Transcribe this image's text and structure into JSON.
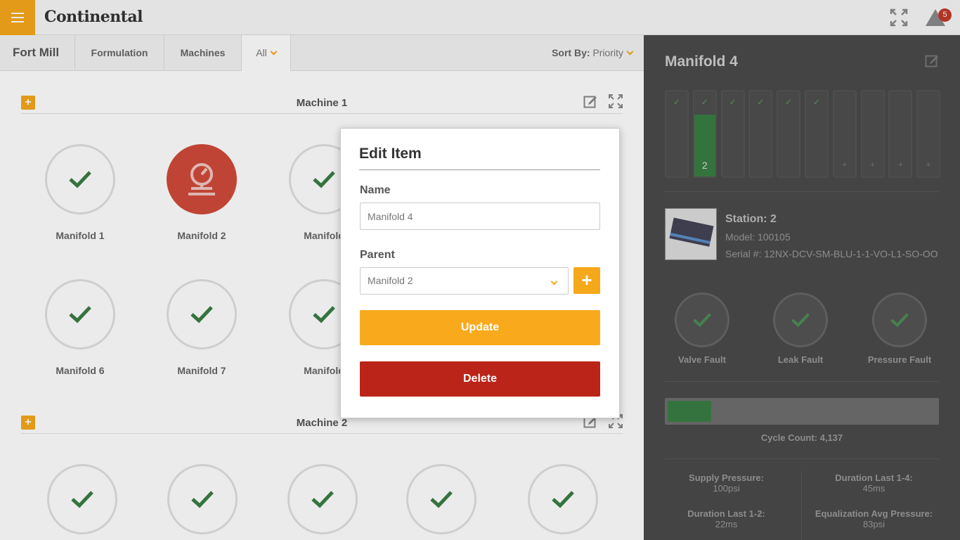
{
  "header": {
    "brand": "Continental",
    "alert_count": "5"
  },
  "tabs": {
    "site": "Fort Mill",
    "items": [
      "Formulation",
      "Machines",
      "All"
    ],
    "sort_label": "Sort By:",
    "sort_value": "Priority"
  },
  "machines": [
    {
      "title": "Machine 1",
      "items": [
        {
          "label": "Manifold 1",
          "status": "ok"
        },
        {
          "label": "Manifold 2",
          "status": "alert"
        },
        {
          "label": "Manifold",
          "status": "ok"
        },
        {
          "label": "Manifold 6",
          "status": "ok"
        },
        {
          "label": "Manifold 7",
          "status": "ok"
        },
        {
          "label": "Manifold",
          "status": "ok"
        }
      ]
    },
    {
      "title": "Machine 2",
      "items": [
        {
          "status": "ok"
        },
        {
          "status": "ok"
        },
        {
          "status": "ok"
        },
        {
          "status": "ok"
        },
        {
          "status": "ok"
        }
      ]
    }
  ],
  "panel": {
    "title": "Manifold 4",
    "stations": [
      {
        "state": "ok"
      },
      {
        "state": "active",
        "number": "2"
      },
      {
        "state": "ok"
      },
      {
        "state": "ok"
      },
      {
        "state": "ok"
      },
      {
        "state": "ok"
      },
      {
        "state": "empty"
      },
      {
        "state": "empty"
      },
      {
        "state": "empty"
      },
      {
        "state": "empty"
      }
    ],
    "station_title": "Station: 2",
    "model": "Model: 100105",
    "serial": "Serial #: 12NX-DCV-SM-BLU-1-1-VO-L1-SO-OO",
    "faults": [
      "Valve Fault",
      "Leak Fault",
      "Pressure Fault"
    ],
    "cycle_count": "Cycle Count: 4,137",
    "stats": [
      {
        "label": "Supply Pressure:",
        "value": "100psi"
      },
      {
        "label": "Duration Last 1-4:",
        "value": "45ms"
      },
      {
        "label": "Duration Last 1-2:",
        "value": "22ms"
      },
      {
        "label": "Equalization Avg Pressure:",
        "value": "83psi"
      }
    ]
  },
  "modal": {
    "title": "Edit Item",
    "name_label": "Name",
    "name_value": "Manifold 4",
    "parent_label": "Parent",
    "parent_value": "Manifold 2",
    "update_label": "Update",
    "delete_label": "Delete"
  },
  "colors": {
    "accent": "#f6a81b",
    "ok": "#3a7d44",
    "alert": "#d04a3a",
    "danger": "#bb2418"
  }
}
